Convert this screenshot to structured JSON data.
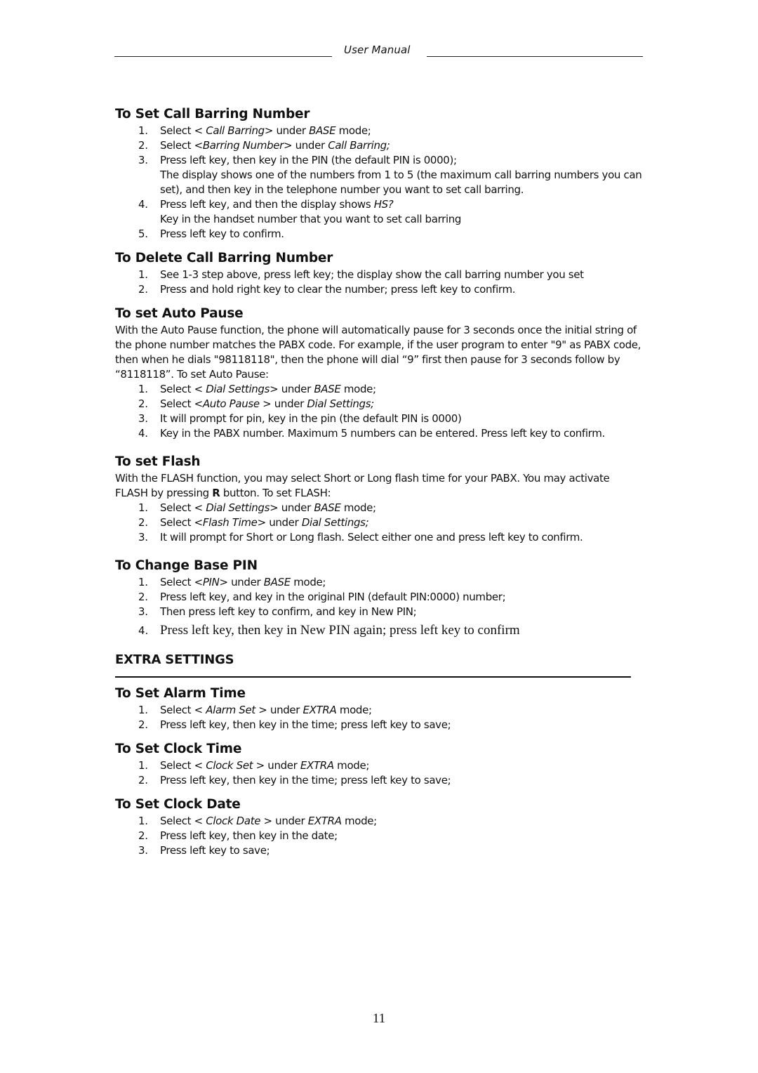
{
  "header": {
    "title": "User Manual"
  },
  "sections": [
    {
      "id": "call-barring-number",
      "heading": "To Set Call Barring Number",
      "intro": null,
      "steps": [
        {
          "num": "1.",
          "segments": [
            [
              "Select < ",
              ""
            ],
            [
              "Call Barring",
              "i"
            ],
            [
              "> under ",
              ""
            ],
            [
              "BASE",
              "i"
            ],
            [
              " mode;",
              ""
            ]
          ]
        },
        {
          "num": "2.",
          "segments": [
            [
              "Select <",
              ""
            ],
            [
              "Barring Number",
              "i"
            ],
            [
              "> under ",
              ""
            ],
            [
              "Call Barring;",
              "i"
            ]
          ]
        },
        {
          "num": "3.",
          "segments": [
            [
              "Press left key, then key in the PIN (the default PIN is 0000);",
              ""
            ]
          ],
          "continuation": [
            [
              [
                "The display shows one of the numbers from 1 to 5 (the maximum call barring numbers you can set), and then key in the telephone number you want to set call barring.",
                ""
              ]
            ]
          ]
        },
        {
          "num": "4.",
          "segments": [
            [
              "Press left key, and then the display shows ",
              ""
            ],
            [
              "HS?",
              "i"
            ]
          ],
          "continuation": [
            [
              [
                "Key in the handset number that you want to set call barring",
                ""
              ]
            ]
          ]
        },
        {
          "num": "5.",
          "segments": [
            [
              "Press left key to confirm.",
              ""
            ]
          ]
        }
      ]
    },
    {
      "id": "delete-call-barring",
      "heading": "To Delete Call Barring Number",
      "intro": null,
      "steps": [
        {
          "num": "1.",
          "segments": [
            [
              "See 1-3 step above, press left key; the display show the call barring number you set",
              ""
            ]
          ]
        },
        {
          "num": "2.",
          "segments": [
            [
              "Press and hold right key to clear the number; press left key to confirm.",
              ""
            ]
          ]
        }
      ]
    },
    {
      "id": "auto-pause",
      "heading": "To set Auto Pause",
      "intro": [
        [
          "With the Auto Pause function, the phone will automatically pause for 3 seconds once the initial string of the phone number matches the PABX code. For example, if the user program to enter \"9\" as PABX code, then when he dials \"98118118\", then the phone will dial “9” first then pause for 3 seconds follow by “8118118”. To set Auto Pause:",
          ""
        ]
      ],
      "steps": [
        {
          "num": "1.",
          "segments": [
            [
              "Select < ",
              ""
            ],
            [
              "Dial Settings",
              "i"
            ],
            [
              "> under ",
              ""
            ],
            [
              "BASE",
              "i"
            ],
            [
              " mode;",
              ""
            ]
          ]
        },
        {
          "num": "2.",
          "segments": [
            [
              "Select <",
              ""
            ],
            [
              "Auto Pause",
              "i"
            ],
            [
              " > under ",
              ""
            ],
            [
              "Dial Settings;",
              "i"
            ]
          ]
        },
        {
          "num": "3.",
          "segments": [
            [
              "It will prompt for pin, key in the pin (the default PIN is 0000)",
              ""
            ]
          ]
        },
        {
          "num": "4.",
          "segments": [
            [
              "Key in the PABX number. Maximum 5 numbers can be entered. Press left key to confirm.",
              ""
            ]
          ]
        }
      ]
    },
    {
      "id": "flash",
      "heading": "To set Flash",
      "intro": [
        [
          "With the FLASH function, you may select Short or Long flash time for your PABX. You may activate FLASH by pressing ",
          ""
        ],
        [
          "R",
          "b"
        ],
        [
          " button. To set FLASH:",
          ""
        ]
      ],
      "steps": [
        {
          "num": "1.",
          "segments": [
            [
              "Select < ",
              ""
            ],
            [
              "Dial Settings",
              "i"
            ],
            [
              "> under ",
              ""
            ],
            [
              "BASE",
              "i"
            ],
            [
              " mode;",
              ""
            ]
          ]
        },
        {
          "num": "2.",
          "segments": [
            [
              "Select <",
              ""
            ],
            [
              "Flash Time",
              "i"
            ],
            [
              "> under ",
              ""
            ],
            [
              "Dial Settings;",
              "i"
            ]
          ]
        },
        {
          "num": "3.",
          "segments": [
            [
              "It will prompt for Short or Long flash. Select either one and press left key to confirm.",
              ""
            ]
          ]
        }
      ]
    },
    {
      "id": "base-pin",
      "heading": "To Change Base PIN",
      "intro": null,
      "steps": [
        {
          "num": "1.",
          "segments": [
            [
              "Select <",
              ""
            ],
            [
              "PIN",
              "i"
            ],
            [
              "> under ",
              ""
            ],
            [
              "BASE",
              "i"
            ],
            [
              " mode;",
              ""
            ]
          ]
        },
        {
          "num": "2.",
          "segments": [
            [
              "Press left key, and key in the original PIN (default PIN:0000) number;",
              ""
            ]
          ]
        },
        {
          "num": "3.",
          "segments": [
            [
              "Then press left key to confirm, and key in New PIN;",
              ""
            ]
          ]
        },
        {
          "num": "4.",
          "serif": true,
          "segments": [
            [
              "Press left key, then key in New PIN again; press left key to confirm",
              ""
            ]
          ]
        }
      ]
    }
  ],
  "extra": {
    "title": "EXTRA SETTINGS",
    "sections": [
      {
        "id": "alarm-time",
        "heading": "To Set Alarm Time",
        "intro": null,
        "steps": [
          {
            "num": "1.",
            "segments": [
              [
                "Select < ",
                ""
              ],
              [
                "Alarm Set",
                "i"
              ],
              [
                " > under ",
                ""
              ],
              [
                "EXTRA",
                "i"
              ],
              [
                " mode;",
                ""
              ]
            ]
          },
          {
            "num": "2.",
            "segments": [
              [
                "Press left key, then key in the time; press left key to save;",
                ""
              ]
            ]
          }
        ]
      },
      {
        "id": "clock-time",
        "heading": "To Set Clock Time",
        "intro": null,
        "steps": [
          {
            "num": "1.",
            "segments": [
              [
                "Select < ",
                ""
              ],
              [
                "Clock Set",
                "i"
              ],
              [
                " > under ",
                ""
              ],
              [
                "EXTRA",
                "i"
              ],
              [
                " mode;",
                ""
              ]
            ]
          },
          {
            "num": "2.",
            "segments": [
              [
                "Press left key, then key in the time; press left key to save;",
                ""
              ]
            ]
          }
        ]
      },
      {
        "id": "clock-date",
        "heading": "To Set Clock Date",
        "intro": null,
        "steps": [
          {
            "num": "1.",
            "segments": [
              [
                "Select < ",
                ""
              ],
              [
                "Clock Date",
                "i"
              ],
              [
                " > under ",
                ""
              ],
              [
                "EXTRA",
                "i"
              ],
              [
                " mode;",
                ""
              ]
            ]
          },
          {
            "num": "2.",
            "segments": [
              [
                "Press left key, then key in the date;",
                ""
              ]
            ]
          },
          {
            "num": "3.",
            "segments": [
              [
                "Press left key to save;",
                ""
              ]
            ]
          }
        ]
      }
    ]
  },
  "footer": {
    "page_number": "11"
  }
}
